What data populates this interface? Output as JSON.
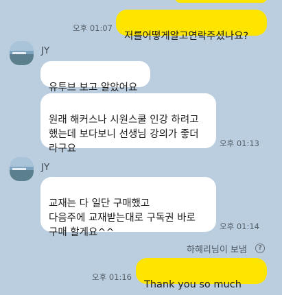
{
  "messages": [
    {
      "id": "m0",
      "direction": "out",
      "text": "",
      "time": ""
    },
    {
      "id": "m1",
      "direction": "out",
      "text": "저를어떻게알고연락주셨나요?",
      "time": "오후 01:07"
    },
    {
      "id": "m2",
      "direction": "in",
      "sender": "JY",
      "text": "유투브 보고 알았어요",
      "time": ""
    },
    {
      "id": "m3",
      "direction": "in",
      "text": "원래 해커스나 시원스쿨 인강 하려고\n했는데 보다보니 선생님 강의가 좋더\n라구요",
      "time": "오후 01:13"
    },
    {
      "id": "m4",
      "direction": "in",
      "sender": "JY",
      "text": "교재는 다 일단 구매했고\n다음주에 교재받는대로 구독권 바로\n구매 할게요^^",
      "time": "오후 01:14"
    },
    {
      "id": "m5",
      "direction": "out",
      "text": "Thank you so much",
      "emoji": "❤",
      "time": "오후 01:16"
    }
  ],
  "sent_by_label": "하혜리님이 보냄",
  "help_icon_glyph": "?",
  "colors": {
    "background": "#bacee0",
    "outgoing_bubble": "#fee500",
    "incoming_bubble": "#ffffff",
    "heart": "#e0283a"
  }
}
